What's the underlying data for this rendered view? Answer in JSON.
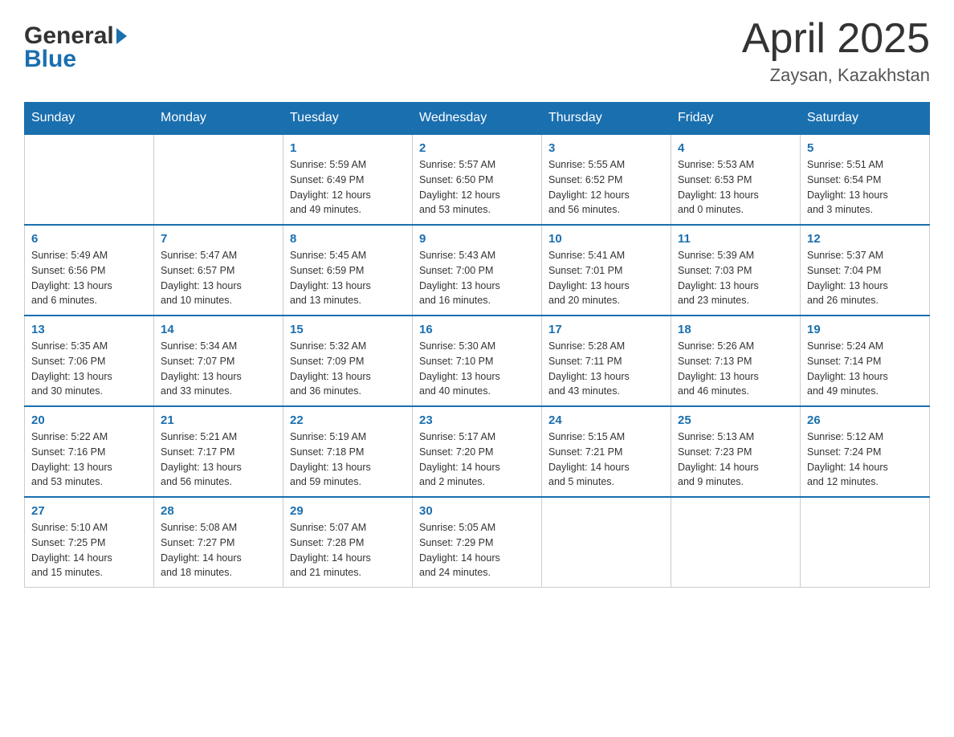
{
  "logo": {
    "general": "General",
    "blue": "Blue"
  },
  "title": "April 2025",
  "subtitle": "Zaysan, Kazakhstan",
  "days_of_week": [
    "Sunday",
    "Monday",
    "Tuesday",
    "Wednesday",
    "Thursday",
    "Friday",
    "Saturday"
  ],
  "weeks": [
    [
      {
        "day": "",
        "info": ""
      },
      {
        "day": "",
        "info": ""
      },
      {
        "day": "1",
        "info": "Sunrise: 5:59 AM\nSunset: 6:49 PM\nDaylight: 12 hours\nand 49 minutes."
      },
      {
        "day": "2",
        "info": "Sunrise: 5:57 AM\nSunset: 6:50 PM\nDaylight: 12 hours\nand 53 minutes."
      },
      {
        "day": "3",
        "info": "Sunrise: 5:55 AM\nSunset: 6:52 PM\nDaylight: 12 hours\nand 56 minutes."
      },
      {
        "day": "4",
        "info": "Sunrise: 5:53 AM\nSunset: 6:53 PM\nDaylight: 13 hours\nand 0 minutes."
      },
      {
        "day": "5",
        "info": "Sunrise: 5:51 AM\nSunset: 6:54 PM\nDaylight: 13 hours\nand 3 minutes."
      }
    ],
    [
      {
        "day": "6",
        "info": "Sunrise: 5:49 AM\nSunset: 6:56 PM\nDaylight: 13 hours\nand 6 minutes."
      },
      {
        "day": "7",
        "info": "Sunrise: 5:47 AM\nSunset: 6:57 PM\nDaylight: 13 hours\nand 10 minutes."
      },
      {
        "day": "8",
        "info": "Sunrise: 5:45 AM\nSunset: 6:59 PM\nDaylight: 13 hours\nand 13 minutes."
      },
      {
        "day": "9",
        "info": "Sunrise: 5:43 AM\nSunset: 7:00 PM\nDaylight: 13 hours\nand 16 minutes."
      },
      {
        "day": "10",
        "info": "Sunrise: 5:41 AM\nSunset: 7:01 PM\nDaylight: 13 hours\nand 20 minutes."
      },
      {
        "day": "11",
        "info": "Sunrise: 5:39 AM\nSunset: 7:03 PM\nDaylight: 13 hours\nand 23 minutes."
      },
      {
        "day": "12",
        "info": "Sunrise: 5:37 AM\nSunset: 7:04 PM\nDaylight: 13 hours\nand 26 minutes."
      }
    ],
    [
      {
        "day": "13",
        "info": "Sunrise: 5:35 AM\nSunset: 7:06 PM\nDaylight: 13 hours\nand 30 minutes."
      },
      {
        "day": "14",
        "info": "Sunrise: 5:34 AM\nSunset: 7:07 PM\nDaylight: 13 hours\nand 33 minutes."
      },
      {
        "day": "15",
        "info": "Sunrise: 5:32 AM\nSunset: 7:09 PM\nDaylight: 13 hours\nand 36 minutes."
      },
      {
        "day": "16",
        "info": "Sunrise: 5:30 AM\nSunset: 7:10 PM\nDaylight: 13 hours\nand 40 minutes."
      },
      {
        "day": "17",
        "info": "Sunrise: 5:28 AM\nSunset: 7:11 PM\nDaylight: 13 hours\nand 43 minutes."
      },
      {
        "day": "18",
        "info": "Sunrise: 5:26 AM\nSunset: 7:13 PM\nDaylight: 13 hours\nand 46 minutes."
      },
      {
        "day": "19",
        "info": "Sunrise: 5:24 AM\nSunset: 7:14 PM\nDaylight: 13 hours\nand 49 minutes."
      }
    ],
    [
      {
        "day": "20",
        "info": "Sunrise: 5:22 AM\nSunset: 7:16 PM\nDaylight: 13 hours\nand 53 minutes."
      },
      {
        "day": "21",
        "info": "Sunrise: 5:21 AM\nSunset: 7:17 PM\nDaylight: 13 hours\nand 56 minutes."
      },
      {
        "day": "22",
        "info": "Sunrise: 5:19 AM\nSunset: 7:18 PM\nDaylight: 13 hours\nand 59 minutes."
      },
      {
        "day": "23",
        "info": "Sunrise: 5:17 AM\nSunset: 7:20 PM\nDaylight: 14 hours\nand 2 minutes."
      },
      {
        "day": "24",
        "info": "Sunrise: 5:15 AM\nSunset: 7:21 PM\nDaylight: 14 hours\nand 5 minutes."
      },
      {
        "day": "25",
        "info": "Sunrise: 5:13 AM\nSunset: 7:23 PM\nDaylight: 14 hours\nand 9 minutes."
      },
      {
        "day": "26",
        "info": "Sunrise: 5:12 AM\nSunset: 7:24 PM\nDaylight: 14 hours\nand 12 minutes."
      }
    ],
    [
      {
        "day": "27",
        "info": "Sunrise: 5:10 AM\nSunset: 7:25 PM\nDaylight: 14 hours\nand 15 minutes."
      },
      {
        "day": "28",
        "info": "Sunrise: 5:08 AM\nSunset: 7:27 PM\nDaylight: 14 hours\nand 18 minutes."
      },
      {
        "day": "29",
        "info": "Sunrise: 5:07 AM\nSunset: 7:28 PM\nDaylight: 14 hours\nand 21 minutes."
      },
      {
        "day": "30",
        "info": "Sunrise: 5:05 AM\nSunset: 7:29 PM\nDaylight: 14 hours\nand 24 minutes."
      },
      {
        "day": "",
        "info": ""
      },
      {
        "day": "",
        "info": ""
      },
      {
        "day": "",
        "info": ""
      }
    ]
  ]
}
